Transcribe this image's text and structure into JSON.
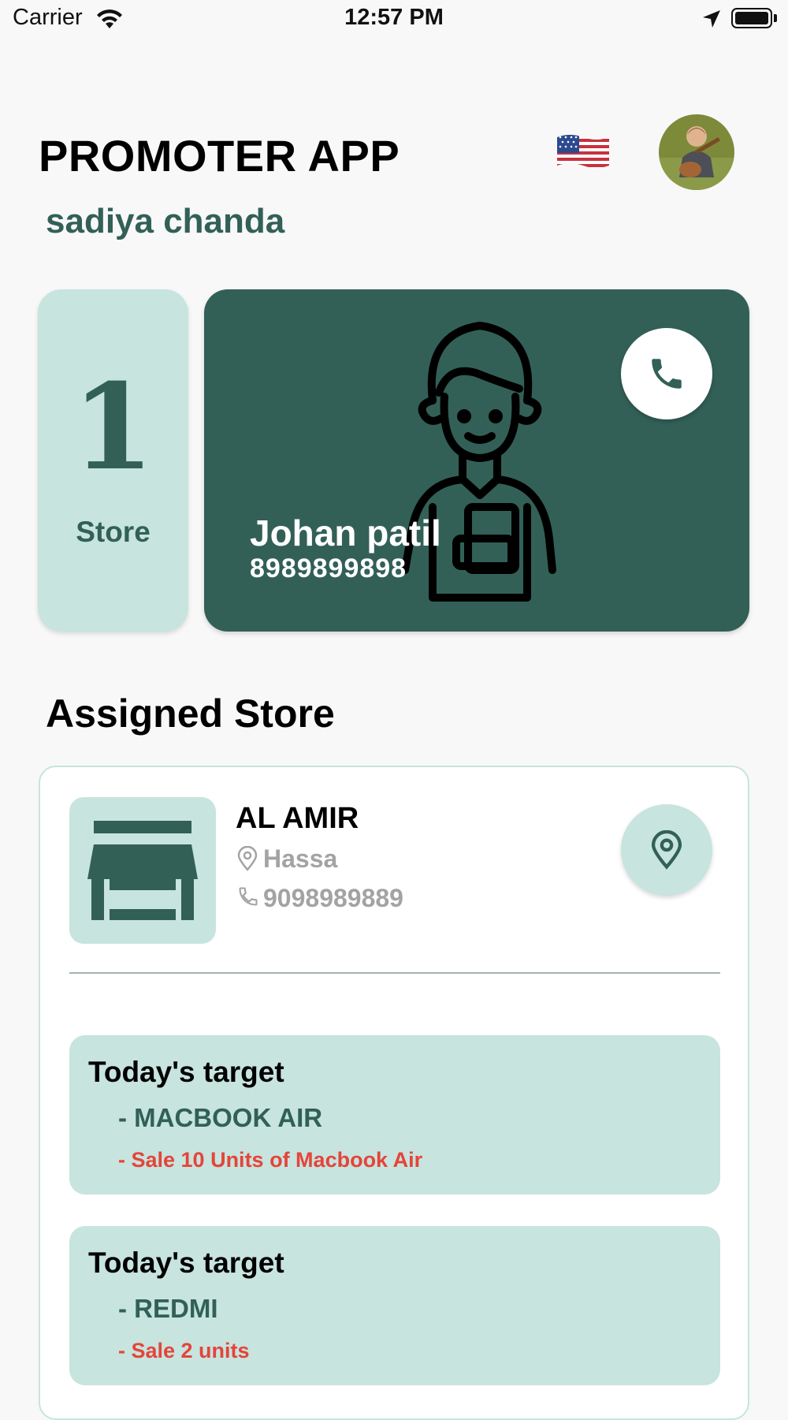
{
  "status_bar": {
    "carrier": "Carrier",
    "time": "12:57 PM",
    "icons": [
      "wifi-icon",
      "location-arrow-icon",
      "battery-icon"
    ]
  },
  "header": {
    "title": "PROMOTER APP",
    "user_name": "sadiya chanda",
    "language_flag": "us-flag-icon",
    "avatar": "profile-avatar"
  },
  "summary": {
    "store_count": "1",
    "store_label": "Store"
  },
  "contact": {
    "name": "Johan patil",
    "phone": "8989899898",
    "call_icon": "phone-icon"
  },
  "assigned_section": {
    "title": "Assigned Store"
  },
  "store": {
    "name": "AL AMIR",
    "city": "Hassa",
    "phone": "9098989889",
    "map_icon": "map-pin-icon"
  },
  "targets": [
    {
      "title": "Today's target",
      "product": "- MACBOOK AIR",
      "detail": "- Sale 10 Units of Macbook Air"
    },
    {
      "title": "Today's target",
      "product": "- REDMI",
      "detail": "- Sale 2 units"
    }
  ],
  "colors": {
    "primary": "#326057",
    "light": "#c7e4de",
    "background": "#f8f8f8",
    "muted_text": "#a3a3a3",
    "alert": "#e5443a"
  }
}
